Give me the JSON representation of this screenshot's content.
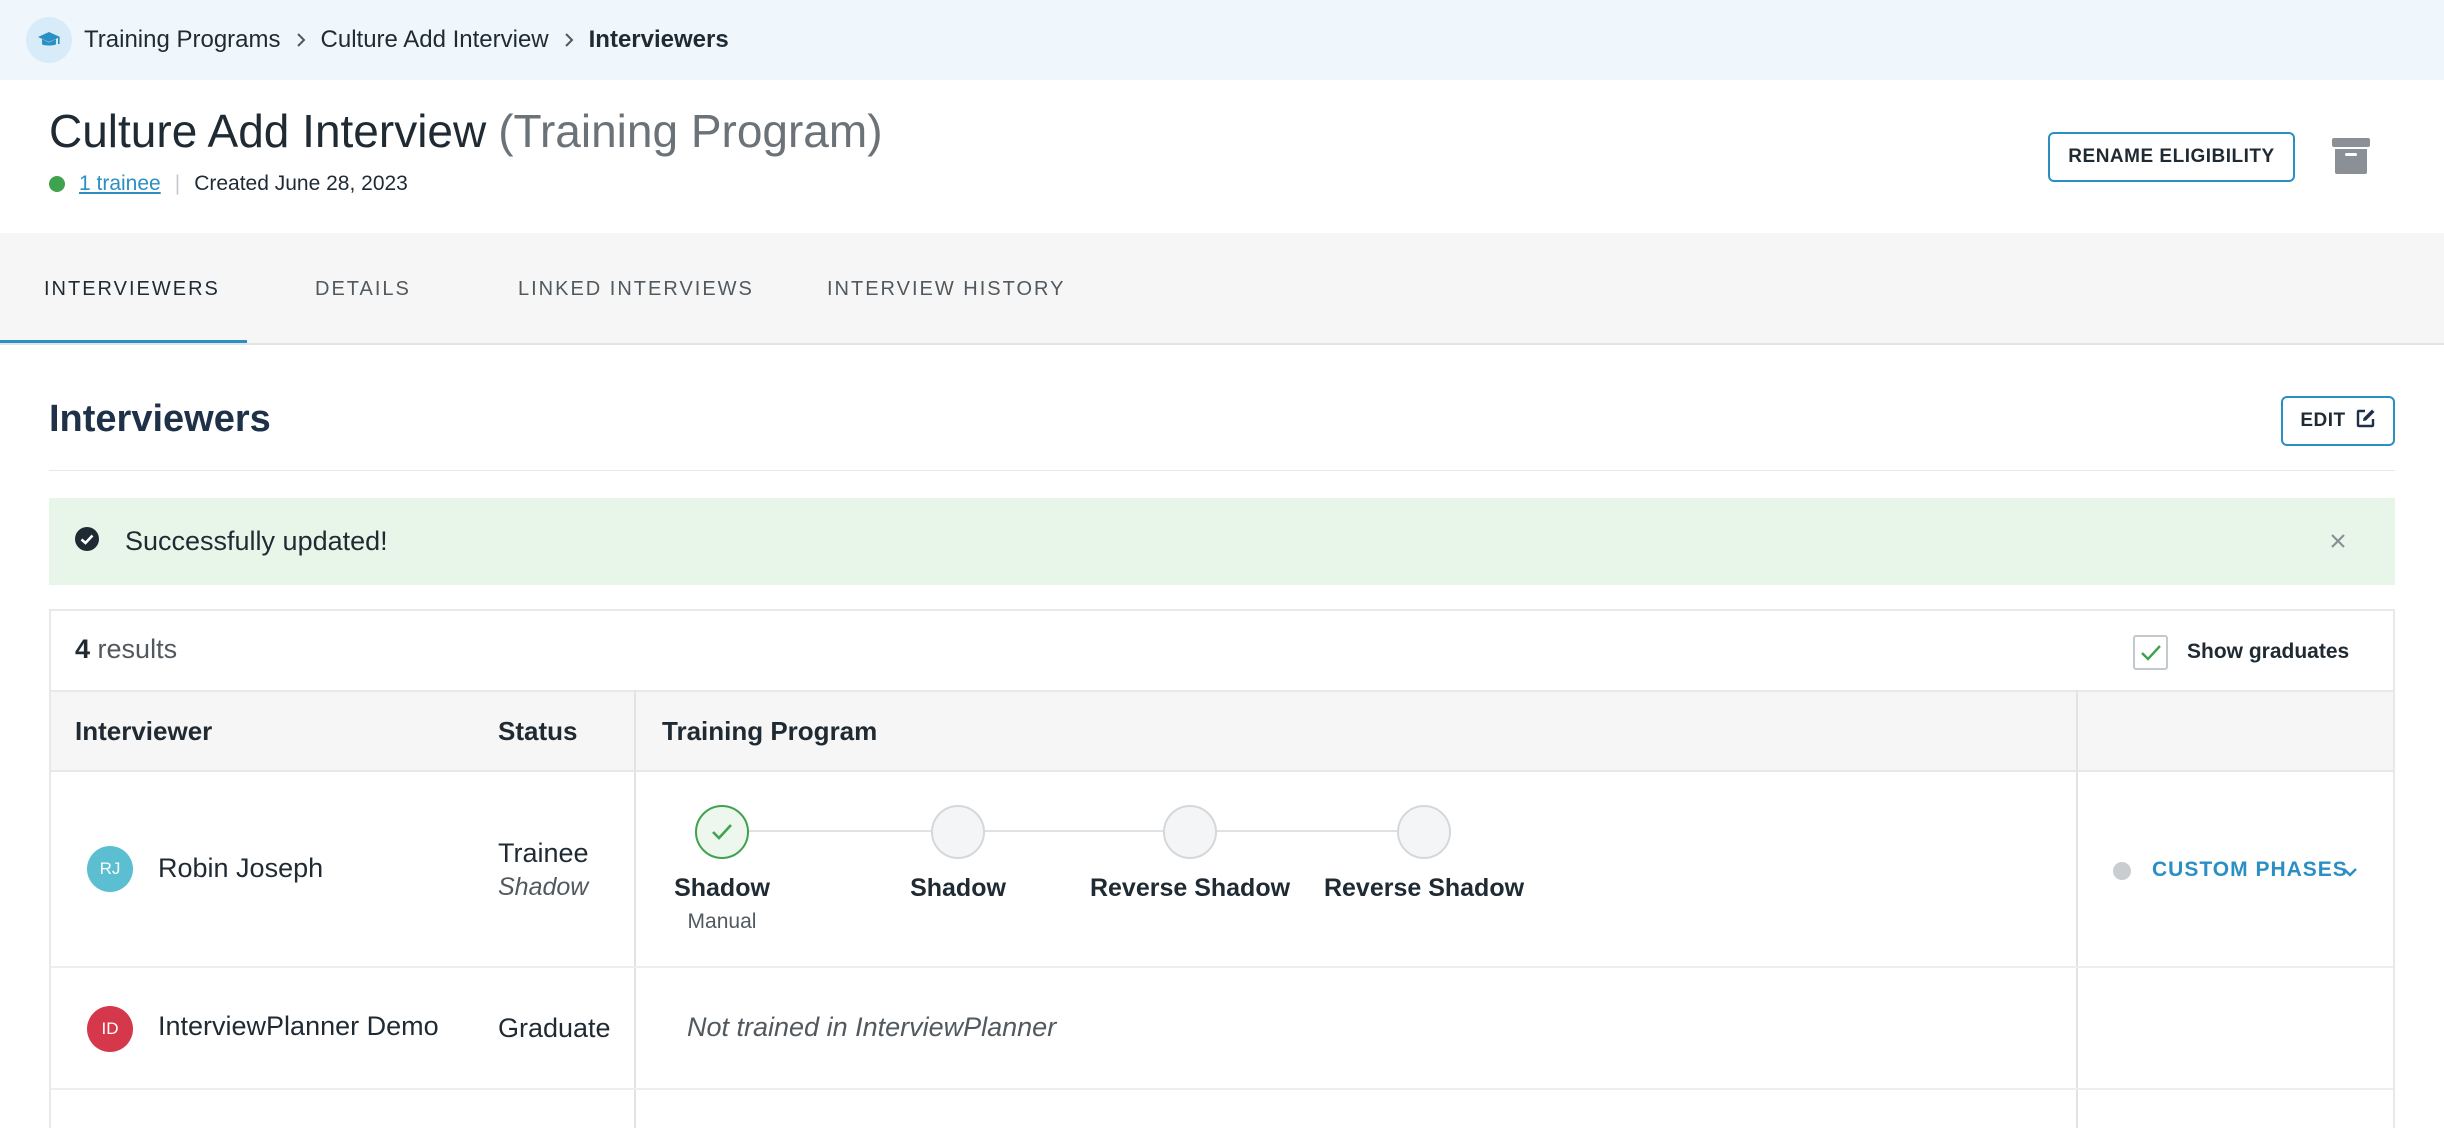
{
  "breadcrumb": {
    "icon": "graduation-cap-icon",
    "items": [
      "Training Programs",
      "Culture Add Interview"
    ],
    "current": "Interviewers"
  },
  "header": {
    "title": "Culture Add Interview",
    "title_suffix": "(Training Program)",
    "trainee_count": "1 trainee",
    "created": "Created June 28, 2023",
    "rename_label": "RENAME ELIGIBILITY",
    "archive_icon": "archive-icon"
  },
  "tabs": [
    {
      "label": "INTERVIEWERS",
      "active": true
    },
    {
      "label": "DETAILS",
      "active": false
    },
    {
      "label": "LINKED INTERVIEWS",
      "active": false
    },
    {
      "label": "INTERVIEW HISTORY",
      "active": false
    }
  ],
  "section": {
    "title": "Interviewers",
    "edit_label": "EDIT"
  },
  "alert": {
    "text": "Successfully updated!"
  },
  "results": {
    "count": "4",
    "label": "results",
    "show_graduates_label": "Show graduates",
    "show_graduates_checked": true
  },
  "table": {
    "headers": [
      "Interviewer",
      "Status",
      "Training Program"
    ],
    "rows": [
      {
        "initials": "RJ",
        "avatar_color": "#5bbfd1",
        "name": "Robin Joseph",
        "status": "Trainee",
        "status_sub": "Shadow",
        "phases": [
          {
            "label": "Shadow",
            "sub": "Manual",
            "done": true
          },
          {
            "label": "Shadow",
            "sub": "",
            "done": false
          },
          {
            "label": "Reverse Shadow",
            "sub": "",
            "done": false
          },
          {
            "label": "Reverse Shadow",
            "sub": "",
            "done": false
          }
        ],
        "action_label": "CUSTOM PHASES"
      },
      {
        "initials": "ID",
        "avatar_color": "#d6384b",
        "name": "InterviewPlanner Demo",
        "status": "Graduate",
        "training_note": "Not trained in InterviewPlanner"
      }
    ]
  },
  "colors": {
    "accent": "#2b8fc4",
    "success": "#3fa24f",
    "alert_bg": "#e8f6ea",
    "breadcrumb_bg": "#eff7fd"
  }
}
